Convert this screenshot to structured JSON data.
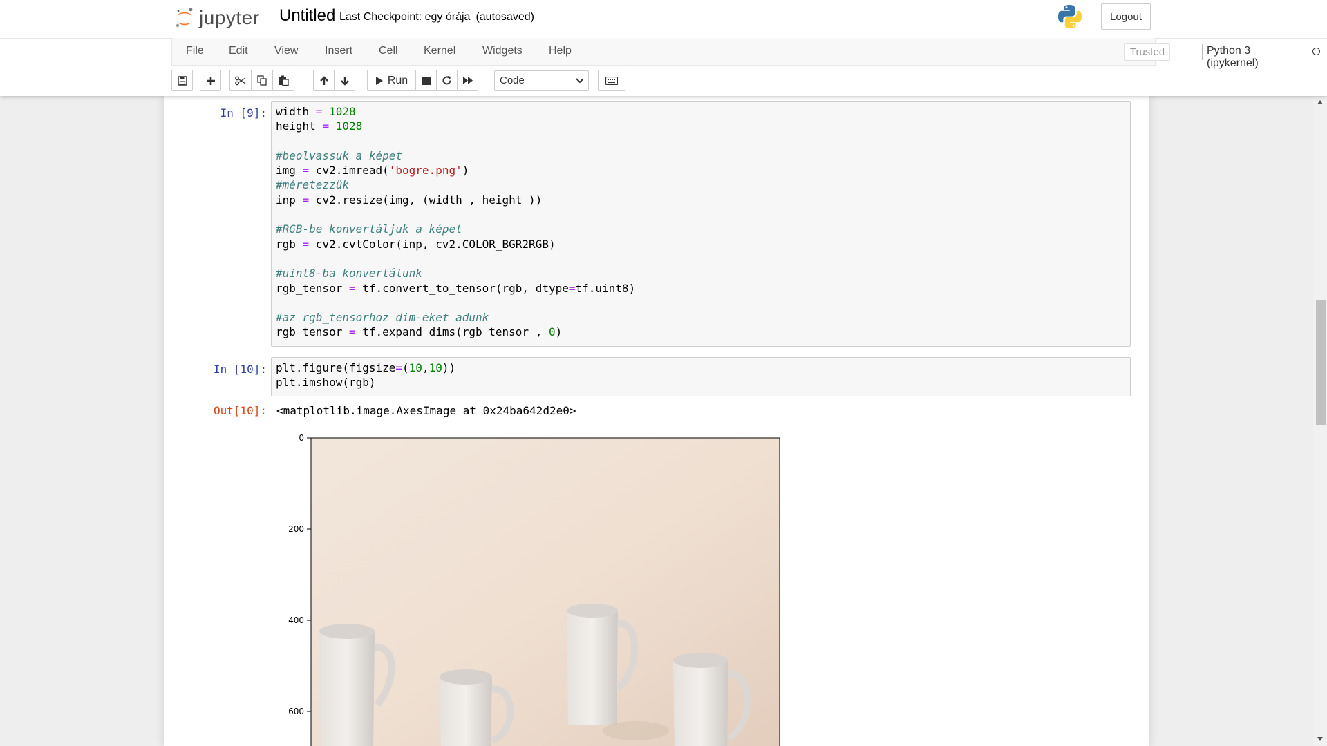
{
  "header": {
    "logo_text": "jupyter",
    "notebook_title": "Untitled",
    "checkpoint_text": "Last Checkpoint: egy órája",
    "autosave_status": "(autosaved)",
    "logout_label": "Logout"
  },
  "menubar": {
    "items": [
      "File",
      "Edit",
      "View",
      "Insert",
      "Cell",
      "Kernel",
      "Widgets",
      "Help"
    ],
    "trusted_label": "Trusted",
    "kernel_name": "Python 3 (ipykernel)"
  },
  "toolbar": {
    "run_label": "Run",
    "cell_type": "Code",
    "icons": [
      "save-icon",
      "plus-icon",
      "cut-icon",
      "copy-icon",
      "paste-icon",
      "arrow-up-icon",
      "arrow-down-icon",
      "play-icon",
      "stop-icon",
      "restart-icon",
      "fast-forward-icon",
      "keyboard-icon"
    ]
  },
  "cells": [
    {
      "prompt": "In [9]:",
      "lines": [
        [
          [
            "width ",
            "plain"
          ],
          [
            "=",
            "op"
          ],
          [
            " ",
            "plain"
          ],
          [
            "1028",
            "num"
          ]
        ],
        [
          [
            "height ",
            "plain"
          ],
          [
            "=",
            "op"
          ],
          [
            " ",
            "plain"
          ],
          [
            "1028",
            "num"
          ]
        ],
        [],
        [
          [
            "#beolvassuk a képet",
            "cmt"
          ]
        ],
        [
          [
            "img ",
            "plain"
          ],
          [
            "=",
            "op"
          ],
          [
            " cv2.imread(",
            "plain"
          ],
          [
            "'bogre.png'",
            "str"
          ],
          [
            ")",
            "plain"
          ]
        ],
        [
          [
            "#méretezzük",
            "cmt"
          ]
        ],
        [
          [
            "inp ",
            "plain"
          ],
          [
            "=",
            "op"
          ],
          [
            " cv2.resize(img, (width , height ))",
            "plain"
          ]
        ],
        [],
        [
          [
            "#RGB-be konvertáljuk a képet",
            "cmt"
          ]
        ],
        [
          [
            "rgb ",
            "plain"
          ],
          [
            "=",
            "op"
          ],
          [
            " cv2.cvtColor(inp, cv2.COLOR_BGR2RGB)",
            "plain"
          ]
        ],
        [],
        [
          [
            "#uint8-ba konvertálunk",
            "cmt"
          ]
        ],
        [
          [
            "rgb_tensor ",
            "plain"
          ],
          [
            "=",
            "op"
          ],
          [
            " tf.convert_to_tensor(rgb, dtype",
            "plain"
          ],
          [
            "=",
            "op"
          ],
          [
            "tf.uint8)",
            "plain"
          ]
        ],
        [],
        [
          [
            "#az rgb_tensorhoz dim-eket adunk",
            "cmt"
          ]
        ],
        [
          [
            "rgb_tensor ",
            "plain"
          ],
          [
            "=",
            "op"
          ],
          [
            " tf.expand_dims(rgb_tensor , ",
            "plain"
          ],
          [
            "0",
            "num"
          ],
          [
            ")",
            "plain"
          ]
        ]
      ]
    },
    {
      "prompt": "In [10]:",
      "lines": [
        [
          [
            "plt.figure(figsize",
            "plain"
          ],
          [
            "=",
            "op"
          ],
          [
            "(",
            "plain"
          ],
          [
            "10",
            "num"
          ],
          [
            ",",
            "plain"
          ],
          [
            "10",
            "num"
          ],
          [
            "))",
            "plain"
          ]
        ],
        [
          [
            "plt.imshow(rgb)",
            "plain"
          ]
        ]
      ]
    }
  ],
  "output": {
    "prompt": "Out[10]:",
    "text": "<matplotlib.image.AxesImage at 0x24ba642d2e0>"
  },
  "plot": {
    "image_description_icon": "image-mugs",
    "y_ticks": [
      "0",
      "200",
      "400",
      "600"
    ]
  },
  "colors": {
    "in_prompt": "#303f9f",
    "out_prompt": "#d84315",
    "keyword_op": "#aa22ff",
    "number": "#008000",
    "string": "#ba2121",
    "comment": "#408080",
    "jupyter_orange": "#f37726"
  }
}
